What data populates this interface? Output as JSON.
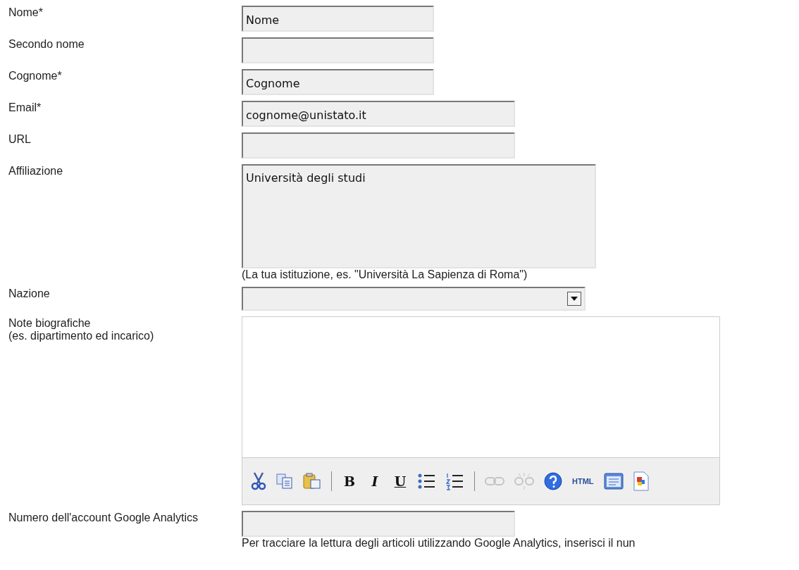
{
  "fields": [
    {
      "kind": "text",
      "label": "Nome*",
      "value": "Nome"
    },
    {
      "kind": "text",
      "label": "Secondo nome"
    },
    {
      "kind": "text",
      "label": "Cognome*",
      "value": "Cognome"
    },
    {
      "kind": "wide",
      "label": "Email*",
      "value": "cognome@unistato.it"
    },
    {
      "kind": "wide",
      "label": "URL"
    },
    {
      "kind": "textarea",
      "label": "Affiliazione",
      "value": "Università degli studi",
      "help": "(La tua istituzione, es. \"Università La Sapienza di Roma\")"
    },
    {
      "kind": "select",
      "label": "Nazione"
    },
    {
      "kind": "editor",
      "label": "Note biografiche",
      "sublabel": "(es. dipartimento ed incarico)",
      "toolbar": [
        {
          "kind": "cut",
          "disabled": false
        },
        {
          "kind": "copy",
          "disabled": false
        },
        {
          "kind": "paste",
          "disabled": false
        },
        {
          "kind": "separator"
        },
        {
          "kind": "bold",
          "label": "B",
          "disabled": false
        },
        {
          "kind": "italic",
          "label": "I",
          "disabled": false
        },
        {
          "kind": "underline",
          "label": "U",
          "disabled": false
        },
        {
          "kind": "bullets",
          "disabled": false
        },
        {
          "kind": "numbers",
          "disabled": false
        },
        {
          "kind": "separator"
        },
        {
          "kind": "link",
          "disabled": true
        },
        {
          "kind": "unlink",
          "disabled": true
        },
        {
          "kind": "help",
          "disabled": false
        },
        {
          "kind": "html",
          "label": "HTML",
          "disabled": false
        },
        {
          "kind": "window",
          "disabled": false
        },
        {
          "kind": "document",
          "disabled": false
        }
      ]
    },
    {
      "kind": "wide",
      "label": "Numero dell'account Google Analytics",
      "help": "Per tracciare la lettura degli articoli utilizzando Google Analytics, inserisci il nun"
    }
  ]
}
